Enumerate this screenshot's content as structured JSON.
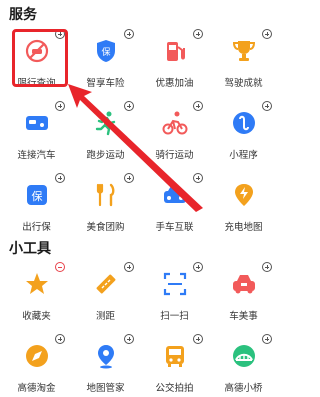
{
  "services": {
    "title": "服务",
    "items": [
      {
        "label": "限行查询",
        "icon": "no-driving-icon",
        "badge": "plus"
      },
      {
        "label": "智享车险",
        "icon": "insurance-shield-icon",
        "badge": "plus"
      },
      {
        "label": "优惠加油",
        "icon": "fuel-pump-icon",
        "badge": "plus"
      },
      {
        "label": "驾驶成就",
        "icon": "trophy-icon",
        "badge": "plus"
      },
      {
        "label": "连接汽车",
        "icon": "car-connect-icon",
        "badge": "plus"
      },
      {
        "label": "跑步运动",
        "icon": "running-icon",
        "badge": "plus"
      },
      {
        "label": "骑行运动",
        "icon": "cycling-icon",
        "badge": "plus"
      },
      {
        "label": "小程序",
        "icon": "mini-program-icon",
        "badge": "plus"
      },
      {
        "label": "出行保",
        "icon": "travel-insurance-icon",
        "badge": "plus"
      },
      {
        "label": "美食团购",
        "icon": "fork-knife-icon",
        "badge": "plus"
      },
      {
        "label": "手车互联",
        "icon": "phone-car-icon",
        "badge": "plus"
      },
      {
        "label": "充电地图",
        "icon": "charging-map-icon",
        "badge": "none"
      }
    ]
  },
  "tools": {
    "title": "小工具",
    "items": [
      {
        "label": "收藏夹",
        "icon": "star-icon",
        "badge": "minus"
      },
      {
        "label": "测距",
        "icon": "ruler-icon",
        "badge": "plus"
      },
      {
        "label": "扫一扫",
        "icon": "scan-icon",
        "badge": "plus"
      },
      {
        "label": "车美事",
        "icon": "car-service-icon",
        "badge": "plus"
      },
      {
        "label": "高德淘金",
        "icon": "gold-compass-icon",
        "badge": "plus"
      },
      {
        "label": "地图管家",
        "icon": "map-pin-icon",
        "badge": "plus"
      },
      {
        "label": "公交拍拍",
        "icon": "bus-camera-icon",
        "badge": "plus"
      },
      {
        "label": "高德小桥",
        "icon": "bridge-icon",
        "badge": "plus"
      }
    ]
  },
  "colors": {
    "red": "#f25a5a",
    "blue": "#2f7bf6",
    "orange": "#f3a11d",
    "green": "#2bc17e",
    "highlight": "#e8252b"
  }
}
